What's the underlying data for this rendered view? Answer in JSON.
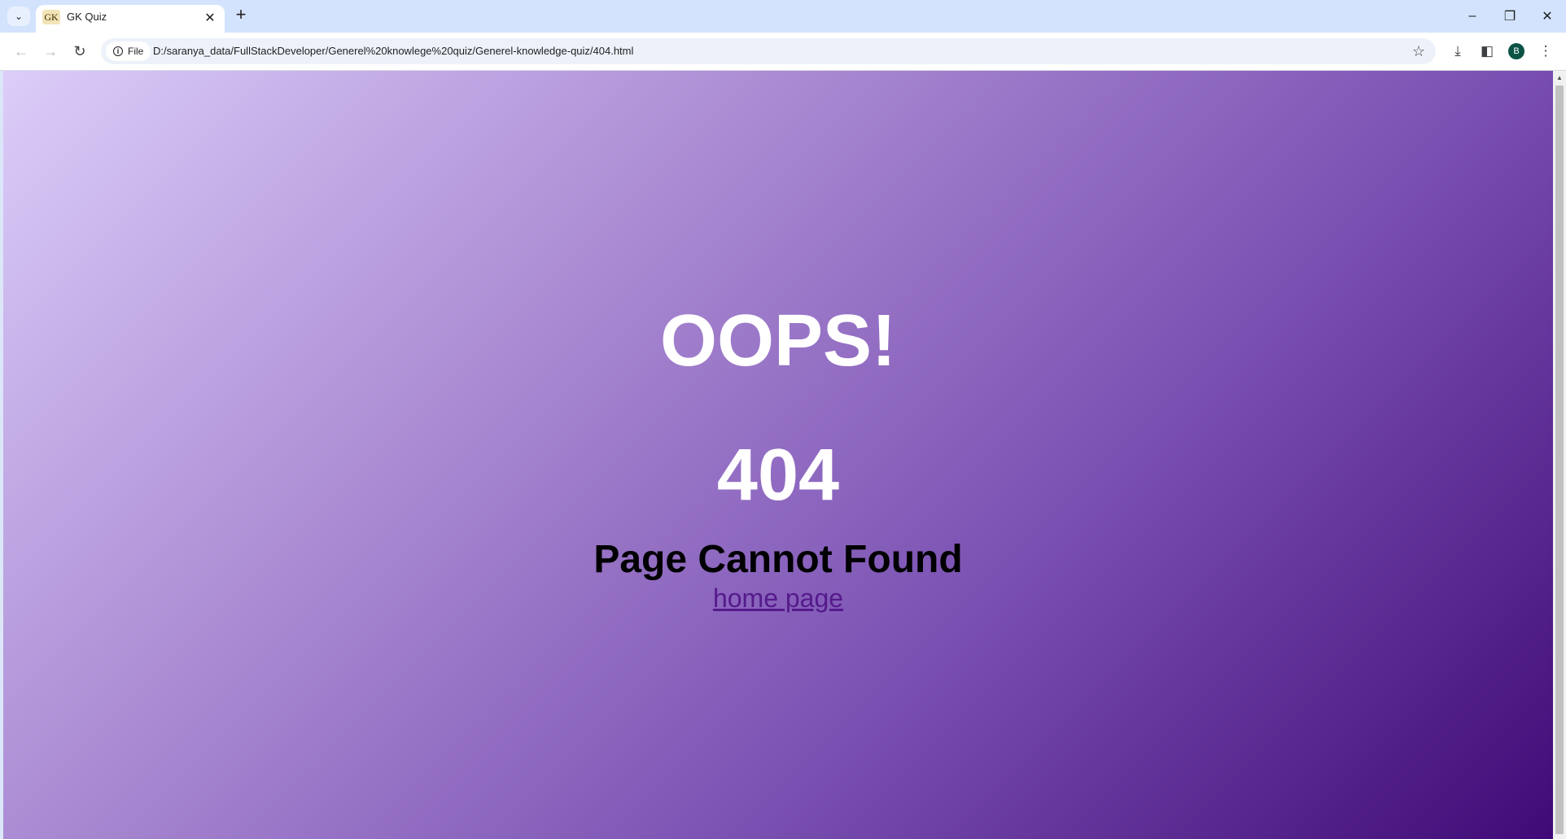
{
  "browser": {
    "tab": {
      "favicon_text": "GK",
      "title": "GK Quiz"
    },
    "omnibox": {
      "site_chip": "File",
      "url": "D:/saranya_data/FullStackDeveloper/Generel%20knowlege%20quiz/Generel-knowledge-quiz/404.html"
    },
    "profile_initial": "B",
    "icons": {
      "tab_search": "chevron-down-icon",
      "tab_close": "close-icon",
      "new_tab": "plus-icon",
      "back": "arrow-left-icon",
      "forward": "arrow-right-icon",
      "reload": "reload-icon",
      "site_info": "info-icon",
      "bookmark": "star-icon",
      "downloads": "download-icon",
      "side_panel": "side-panel-icon",
      "menu": "kebab-menu-icon",
      "minimize": "minimize-icon",
      "restore": "restore-icon",
      "close_window": "close-icon"
    }
  },
  "page": {
    "heading": "OOPS!",
    "error_code": "404",
    "message": "Page Cannot Found",
    "home_link": "home page",
    "colors": {
      "gradient_start": "#dccdf9",
      "gradient_end": "#400a76",
      "heading_text": "#ffffff",
      "message_text": "#000000",
      "link_text": "#551a8b"
    }
  }
}
